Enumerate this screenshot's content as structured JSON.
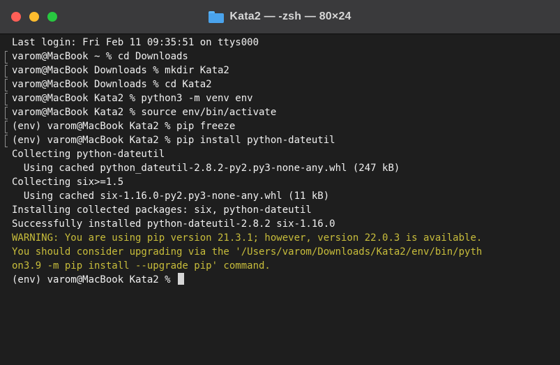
{
  "window": {
    "title": "Kata2 — -zsh — 80×24",
    "folder_icon": "folder-icon",
    "colors": {
      "background": "#1e1e1e",
      "titlebar": "#3a3a3c",
      "text": "#f0f0f0",
      "warning": "#c8bd3b",
      "close": "#ff5f57",
      "minimize": "#febc2e",
      "zoom": "#28c840"
    }
  },
  "terminal": {
    "lines": [
      {
        "text": "Last login: Fri Feb 11 09:35:51 on ttys000",
        "kind": "output"
      },
      {
        "text": "varom@MacBook ~ % cd Downloads",
        "kind": "command"
      },
      {
        "text": "varom@MacBook Downloads % mkdir Kata2",
        "kind": "command"
      },
      {
        "text": "varom@MacBook Downloads % cd Kata2",
        "kind": "command"
      },
      {
        "text": "varom@MacBook Kata2 % python3 -m venv env",
        "kind": "command"
      },
      {
        "text": "varom@MacBook Kata2 % source env/bin/activate",
        "kind": "command"
      },
      {
        "text": "(env) varom@MacBook Kata2 % pip freeze",
        "kind": "command"
      },
      {
        "text": "(env) varom@MacBook Kata2 % pip install python-dateutil",
        "kind": "command"
      },
      {
        "text": "Collecting python-dateutil",
        "kind": "output"
      },
      {
        "text": "  Using cached python_dateutil-2.8.2-py2.py3-none-any.whl (247 kB)",
        "kind": "output"
      },
      {
        "text": "Collecting six>=1.5",
        "kind": "output"
      },
      {
        "text": "  Using cached six-1.16.0-py2.py3-none-any.whl (11 kB)",
        "kind": "output"
      },
      {
        "text": "Installing collected packages: six, python-dateutil",
        "kind": "output"
      },
      {
        "text": "Successfully installed python-dateutil-2.8.2 six-1.16.0",
        "kind": "output"
      },
      {
        "text": "WARNING: You are using pip version 21.3.1; however, version 22.0.3 is available.",
        "kind": "warning"
      },
      {
        "text": "You should consider upgrading via the '/Users/varom/Downloads/Kata2/env/bin/pyth",
        "kind": "warning"
      },
      {
        "text": "on3.9 -m pip install --upgrade pip' command.",
        "kind": "warning"
      }
    ],
    "prompt": "(env) varom@MacBook Kata2 % "
  }
}
